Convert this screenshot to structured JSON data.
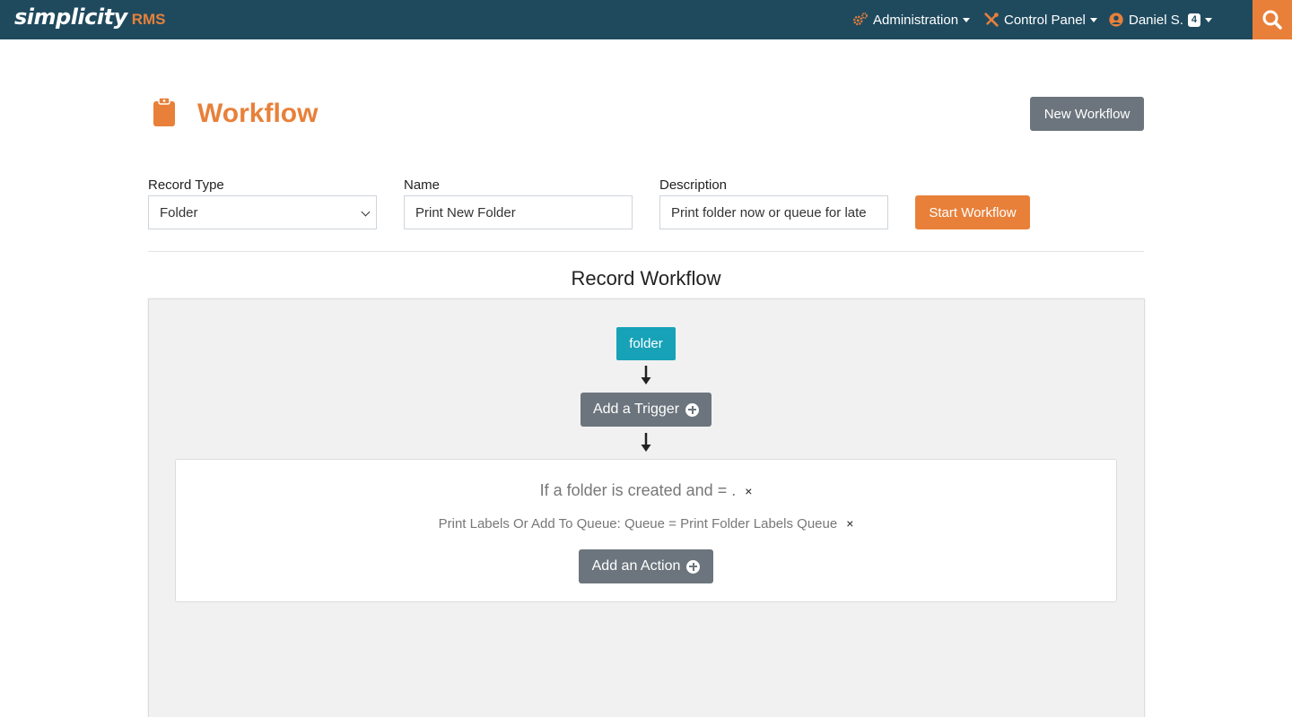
{
  "header": {
    "brand_main": "simplicity",
    "brand_sub": "RMS",
    "nav": [
      {
        "label": "Administration",
        "icon": "cogs-icon"
      },
      {
        "label": "Control Panel",
        "icon": "tools-icon"
      },
      {
        "label": "Daniel S.",
        "icon": "user-circle-icon",
        "badge": "4"
      }
    ],
    "search_icon": "search-icon"
  },
  "page": {
    "title": "Workflow",
    "icon": "clipboard-icon",
    "new_button": "New Workflow"
  },
  "form": {
    "record_type": {
      "label": "Record Type",
      "value": "Folder"
    },
    "name": {
      "label": "Name",
      "value": "Print New Folder"
    },
    "description": {
      "label": "Description",
      "value": "Print folder now or queue for late"
    },
    "start_button": "Start Workflow"
  },
  "workflow": {
    "title": "Record Workflow",
    "start_node": "folder",
    "trigger_button": "Add a Trigger",
    "condition": "If a folder is created and = .",
    "action": "Print Labels Or Add To Queue: Queue = Print Folder Labels Queue",
    "remove_symbol": "×",
    "action_button": "Add an Action"
  },
  "colors": {
    "nav_bg": "#1f4a5e",
    "accent": "#e8803a",
    "secondary_btn": "#6c757d",
    "node": "#17a2b8"
  }
}
